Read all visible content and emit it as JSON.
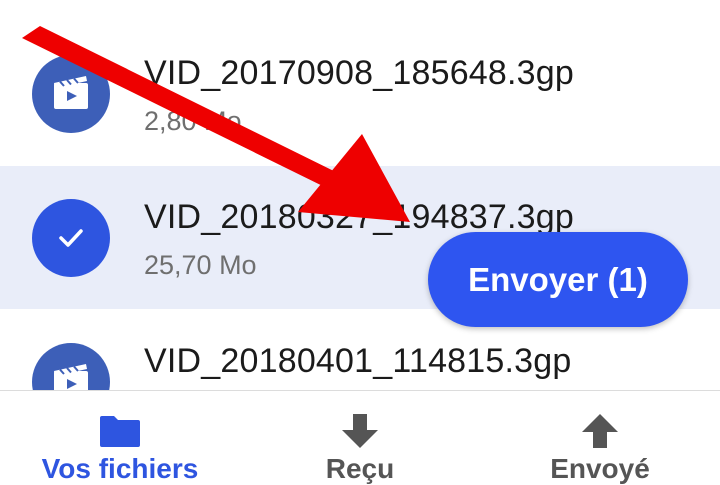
{
  "colors": {
    "accent": "#2e55e0",
    "selected_row": "#e9edf9",
    "icon_circle": "#3d5fb8",
    "annotation_arrow": "#ee0000"
  },
  "files": [
    {
      "name": "VID_20170908_185648.3gp",
      "size": "2,80 Mo",
      "icon": "video-icon",
      "selected": false
    },
    {
      "name": "VID_20180327_194837.3gp",
      "size": "25,70 Mo",
      "icon": "check-icon",
      "selected": true
    },
    {
      "name": "VID_20180401_114815.3gp",
      "size": "",
      "icon": "video-icon",
      "selected": false
    }
  ],
  "send_button": {
    "label": "Envoyer (1)"
  },
  "bottom_nav": {
    "files": {
      "label": "Vos fichiers",
      "icon": "folder-icon",
      "active": true
    },
    "received": {
      "label": "Reçu",
      "icon": "download-arrow-icon"
    },
    "sent": {
      "label": "Envoyé",
      "icon": "upload-arrow-icon"
    }
  }
}
